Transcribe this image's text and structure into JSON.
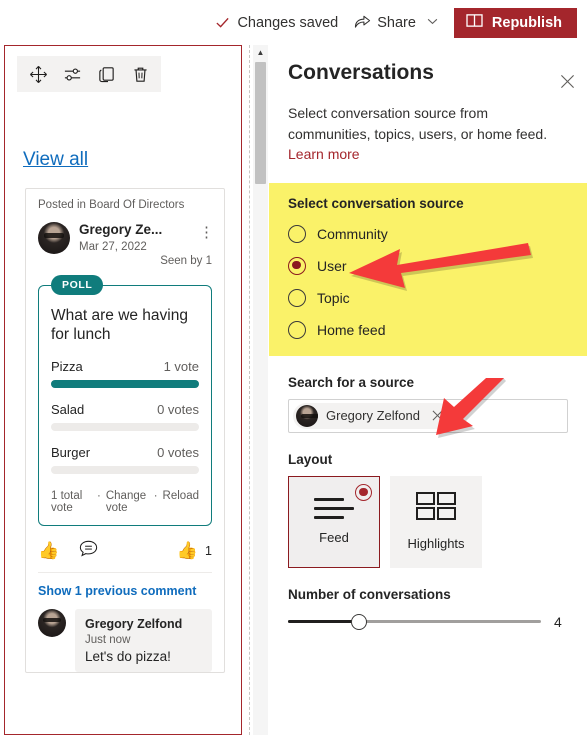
{
  "topbar": {
    "saved_label": "Changes saved",
    "share_label": "Share",
    "republish_label": "Republish",
    "check_icon": "checkmark-icon",
    "share_icon": "share-icon",
    "caret_icon": "chevron-down-icon",
    "republish_icon": "publish-page-icon"
  },
  "canvas": {
    "toolbar": {
      "move_icon": "move-handle-icon",
      "edit_icon": "edit-properties-icon",
      "duplicate_icon": "duplicate-icon",
      "delete_icon": "trash-icon"
    },
    "view_all_label": "View all",
    "post": {
      "posted_in": "Posted in Board Of Directors",
      "author": "Gregory Ze...",
      "date": "Mar 27, 2022",
      "seen_by": "Seen by 1",
      "kebab_icon": "more-options-icon",
      "poll": {
        "badge": "POLL",
        "question": "What are we having for lunch",
        "options": [
          {
            "label": "Pizza",
            "votes": "1 vote",
            "percent": 100
          },
          {
            "label": "Salad",
            "votes": "0 votes",
            "percent": 0
          },
          {
            "label": "Burger",
            "votes": "0 votes",
            "percent": 0
          }
        ],
        "total": "1 total vote",
        "change": "Change vote",
        "reload": "Reload",
        "sep1": "·",
        "sep2": "·"
      },
      "reactions": {
        "like_icon": "thumbs-up-icon",
        "comment_icon": "comment-icon",
        "like_glyph": "👍",
        "comment_glyph": "💬",
        "count": "1"
      },
      "show_previous": "Show 1 previous comment",
      "comment": {
        "author": "Gregory Zelfond",
        "time": "Just now",
        "text": "Let's do pizza!"
      }
    }
  },
  "scrollbar": {
    "up_glyph": "▲"
  },
  "pane": {
    "title": "Conversations",
    "close_icon": "close-icon",
    "description": "Select conversation source from communities, topics, users, or home feed.",
    "learn_more": "Learn more",
    "source_section": {
      "label": "Select conversation source",
      "highlight_color": "#FAF269",
      "options": [
        {
          "label": "Community",
          "selected": false
        },
        {
          "label": "User",
          "selected": true
        },
        {
          "label": "Topic",
          "selected": false
        },
        {
          "label": "Home feed",
          "selected": false
        }
      ]
    },
    "search": {
      "label": "Search for a source",
      "placeholder": "",
      "chip": {
        "name": "Gregory Zelfond",
        "remove_icon": "remove-chip-icon"
      }
    },
    "layout": {
      "label": "Layout",
      "tiles": [
        {
          "label": "Feed",
          "icon": "feed-lines-icon",
          "selected": true
        },
        {
          "label": "Highlights",
          "icon": "highlights-grid-icon",
          "selected": false
        }
      ]
    },
    "count": {
      "label": "Number of conversations",
      "value": "4",
      "percent": 28
    },
    "accent_color": "#A4262C"
  },
  "annotations": {
    "arrow_color": "#F43A3A",
    "arrow_user": "arrow-pointing-to-user-option",
    "arrow_source": "arrow-pointing-to-source-chip"
  }
}
